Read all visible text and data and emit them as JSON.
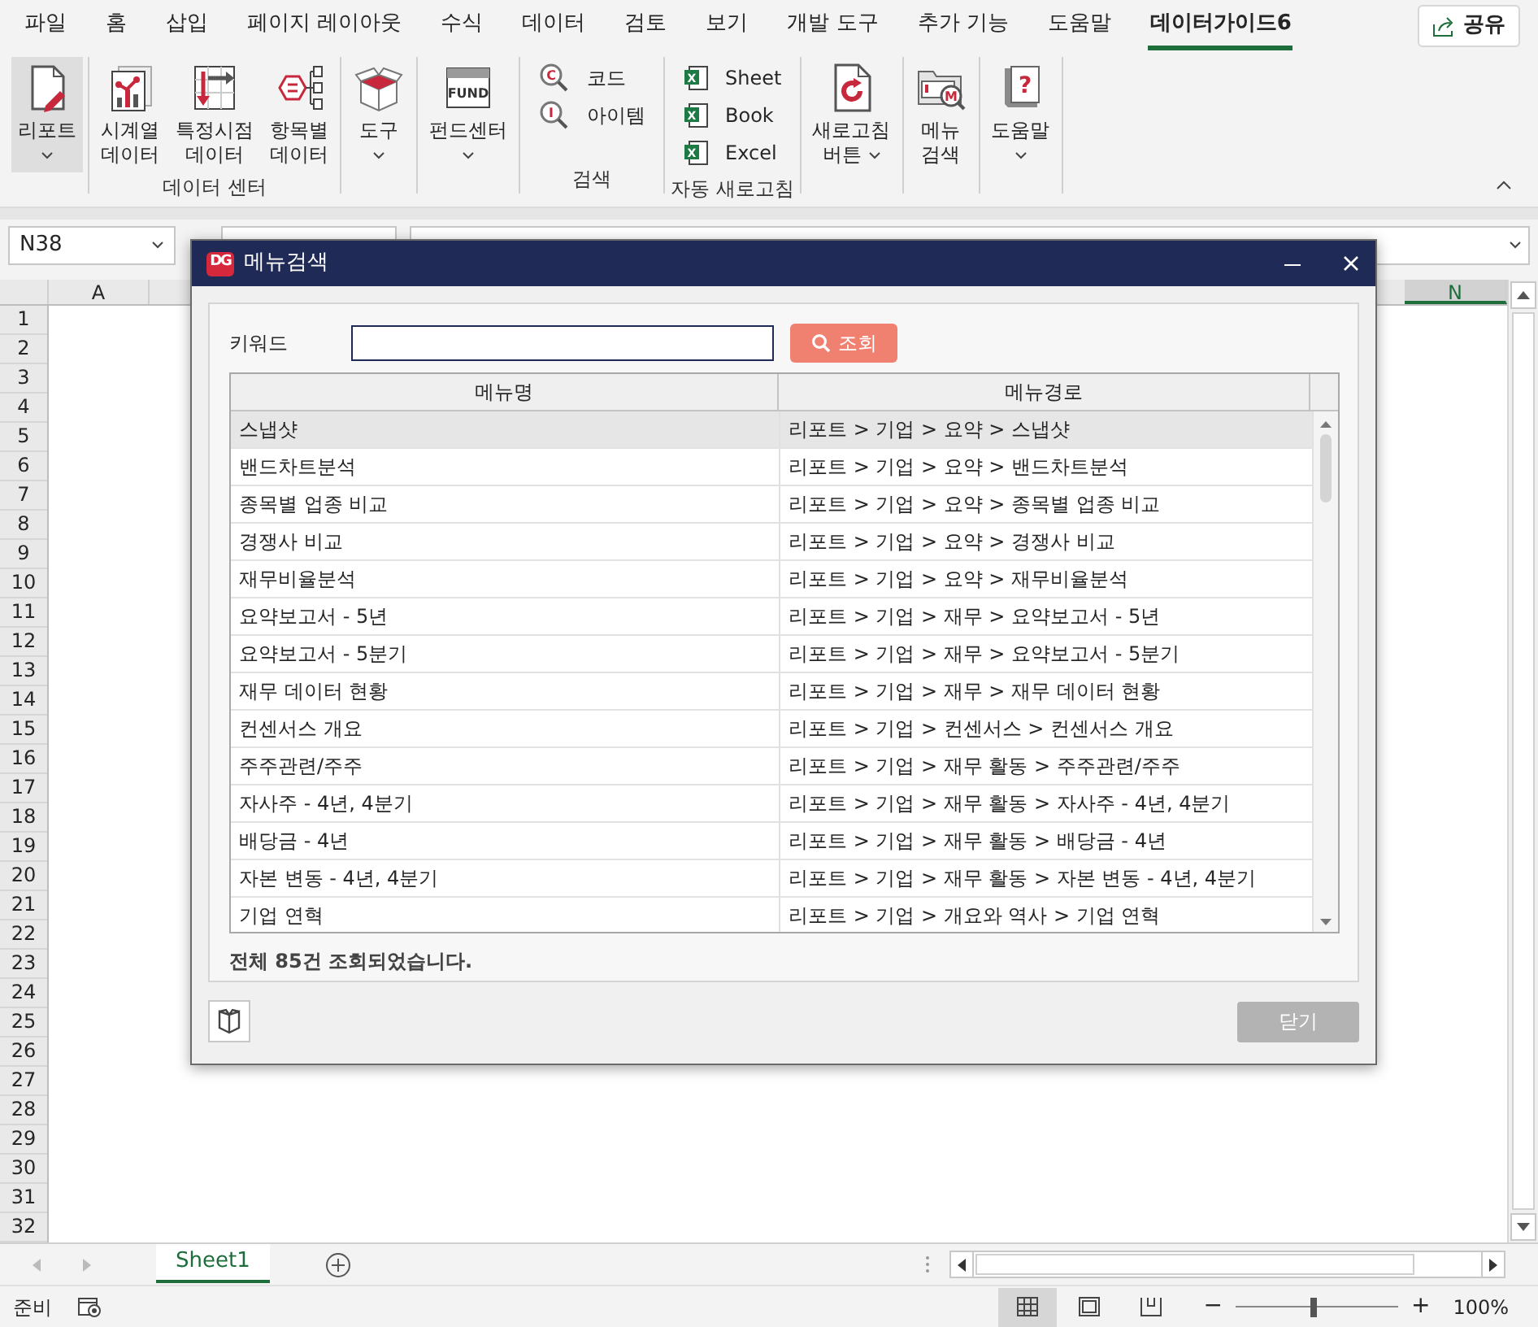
{
  "ribbon_tabs": [
    {
      "label": "파일",
      "selected": false
    },
    {
      "label": "홈",
      "selected": false
    },
    {
      "label": "삽입",
      "selected": false
    },
    {
      "label": "페이지 레이아웃",
      "selected": false
    },
    {
      "label": "수식",
      "selected": false
    },
    {
      "label": "데이터",
      "selected": false
    },
    {
      "label": "검토",
      "selected": false
    },
    {
      "label": "보기",
      "selected": false
    },
    {
      "label": "개발 도구",
      "selected": false
    },
    {
      "label": "추가 기능",
      "selected": false
    },
    {
      "label": "도움말",
      "selected": false
    },
    {
      "label": "데이터가이드6",
      "selected": true
    }
  ],
  "share_button": {
    "label": "공유"
  },
  "ribbon_groups": [
    {
      "items": [
        {
          "kind": "large",
          "lines": [
            "리포트"
          ],
          "dropdown": true,
          "pressed": true
        }
      ]
    },
    {
      "label": "데이터 센터",
      "items": [
        {
          "kind": "large",
          "lines": [
            "시계열",
            "데이터"
          ],
          "dropdown": false,
          "pressed": false
        },
        {
          "kind": "large",
          "lines": [
            "특정시점",
            "데이터"
          ],
          "dropdown": false,
          "pressed": false
        },
        {
          "kind": "large",
          "lines": [
            "항목별",
            "데이터"
          ],
          "dropdown": false,
          "pressed": false
        }
      ]
    },
    {
      "items": [
        {
          "kind": "large",
          "lines": [
            "도구"
          ],
          "dropdown": true,
          "pressed": false
        }
      ]
    },
    {
      "items": [
        {
          "kind": "large",
          "lines": [
            "펀드센터"
          ],
          "dropdown": true,
          "pressed": false,
          "icon_text": "FUND"
        }
      ]
    },
    {
      "label": "검색",
      "items": [
        {
          "kind": "small",
          "label": "코드",
          "icon_text": "C"
        },
        {
          "kind": "small",
          "label": "아이템",
          "icon_text": "I"
        }
      ]
    },
    {
      "label": "자동 새로고침",
      "items": [
        {
          "kind": "small",
          "label": "Sheet",
          "icon_text": "X"
        },
        {
          "kind": "small",
          "label": "Book",
          "icon_text": "X"
        },
        {
          "kind": "small",
          "label": "Excel",
          "icon_text": "X"
        }
      ]
    },
    {
      "items": [
        {
          "kind": "large",
          "lines": [
            "새로고침",
            "버튼"
          ],
          "dropdown": true,
          "pressed": false
        }
      ]
    },
    {
      "items": [
        {
          "kind": "large",
          "lines": [
            "메뉴",
            "검색"
          ],
          "dropdown": false,
          "pressed": false,
          "icon_text": "M"
        }
      ]
    },
    {
      "items": [
        {
          "kind": "large",
          "lines": [
            "도움말"
          ],
          "dropdown": true,
          "pressed": false,
          "icon_text": "?"
        }
      ]
    }
  ],
  "name_box": "N38",
  "column_headers": [
    {
      "label": "A",
      "selected": false
    },
    {
      "label": "N",
      "selected": true
    }
  ],
  "row_numbers": [
    "1",
    "2",
    "3",
    "4",
    "5",
    "6",
    "7",
    "8",
    "9",
    "10",
    "11",
    "12",
    "13",
    "14",
    "15",
    "16",
    "17",
    "18",
    "19",
    "20",
    "21",
    "22",
    "23",
    "24",
    "25",
    "26",
    "27",
    "28",
    "29",
    "30",
    "31",
    "32"
  ],
  "sheet_tabs": [
    {
      "label": "Sheet1",
      "selected": true
    }
  ],
  "status_bar": {
    "text": "준비",
    "views": [
      {
        "selected": true
      },
      {
        "selected": false
      },
      {
        "selected": false
      }
    ],
    "zoom_out": "−",
    "zoom_in": "+",
    "zoom": {
      "level": 0.48
    },
    "zoom_percent": "100%"
  },
  "menu_dialog": {
    "logo": "DG",
    "title": "메뉴검색",
    "keyword_label": "키워드",
    "search_button": "조회",
    "columns": [
      "메뉴명",
      "메뉴경로"
    ],
    "rows": [
      {
        "name": "스냅샷",
        "path": "리포트 > 기업 > 요약 > 스냅샷",
        "selected": true
      },
      {
        "name": "밴드차트분석",
        "path": "리포트 > 기업 > 요약 > 밴드차트분석",
        "selected": false
      },
      {
        "name": "종목별 업종 비교",
        "path": "리포트 > 기업 > 요약 > 종목별 업종 비교",
        "selected": false
      },
      {
        "name": "경쟁사 비교",
        "path": "리포트 > 기업 > 요약 > 경쟁사 비교",
        "selected": false
      },
      {
        "name": "재무비율분석",
        "path": "리포트 > 기업 > 요약 > 재무비율분석",
        "selected": false
      },
      {
        "name": "요약보고서 - 5년",
        "path": "리포트 > 기업 > 재무 > 요약보고서 - 5년",
        "selected": false
      },
      {
        "name": "요약보고서 - 5분기",
        "path": "리포트 > 기업 > 재무 > 요약보고서 - 5분기",
        "selected": false
      },
      {
        "name": "재무 데이터 현황",
        "path": "리포트 > 기업 > 재무 > 재무 데이터 현황",
        "selected": false
      },
      {
        "name": "컨센서스 개요",
        "path": "리포트 > 기업 > 컨센서스 > 컨센서스 개요",
        "selected": false
      },
      {
        "name": "주주관련/주주",
        "path": "리포트 > 기업 > 재무 활동 > 주주관련/주주",
        "selected": false
      },
      {
        "name": "자사주 - 4년, 4분기",
        "path": "리포트 > 기업 > 재무 활동 > 자사주 - 4년, 4분기",
        "selected": false
      },
      {
        "name": "배당금 - 4년",
        "path": "리포트 > 기업 > 재무 활동 > 배당금 - 4년",
        "selected": false
      },
      {
        "name": "자본 변동 - 4년, 4분기",
        "path": "리포트 > 기업 > 재무 활동 > 자본 변동 - 4년, 4분기",
        "selected": false
      },
      {
        "name": "기업 연혁",
        "path": "리포트 > 기업 > 개요와 역사 > 기업 연혁",
        "selected": false
      }
    ],
    "result_text": "전체 85건 조회되었습니다.",
    "close_button": "닫기"
  }
}
